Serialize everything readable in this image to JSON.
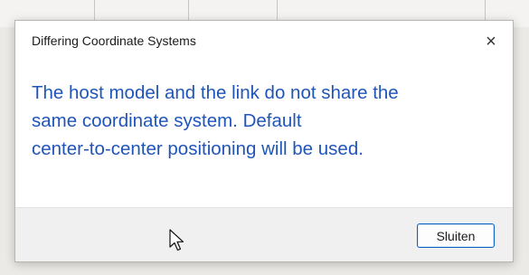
{
  "dialog": {
    "title": "Differing Coordinate Systems",
    "close_icon": "×",
    "message_lines": [
      "The host model and the link do not share the",
      "same coordinate system. Default",
      "center-to-center positioning will be used."
    ],
    "button_label": "Sluiten"
  },
  "colors": {
    "message_text": "#2055b8",
    "button_border": "#0b63c7"
  },
  "icons": {
    "close": "close-icon",
    "cursor": "mouse-pointer-icon"
  }
}
